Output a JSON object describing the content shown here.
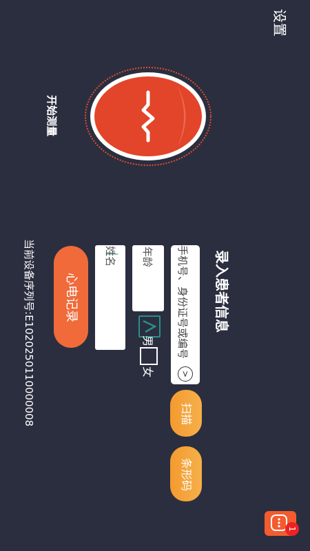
{
  "header": {
    "settings_label": "设置"
  },
  "measure": {
    "start_label": "开始测量"
  },
  "form": {
    "title": "录入患者信息",
    "id_placeholder": "手机号、身份证号或编号",
    "age_placeholder": "年龄",
    "name_placeholder": "姓名",
    "gender": {
      "male_label": "男",
      "female_label": "女",
      "selected": "男"
    },
    "scan_label": "扫描",
    "barcode_label": "条形码"
  },
  "ecg_record_label": "心电记录",
  "device": {
    "serial_text": "当前设备序列号:E1020250110000008"
  },
  "chat": {
    "badge_count": "1"
  },
  "colors": {
    "background": "#2b2e3f",
    "accent_orange": "#f06a3a",
    "button_gradient": "#f39a2f",
    "check_teal": "#2a8f87"
  }
}
